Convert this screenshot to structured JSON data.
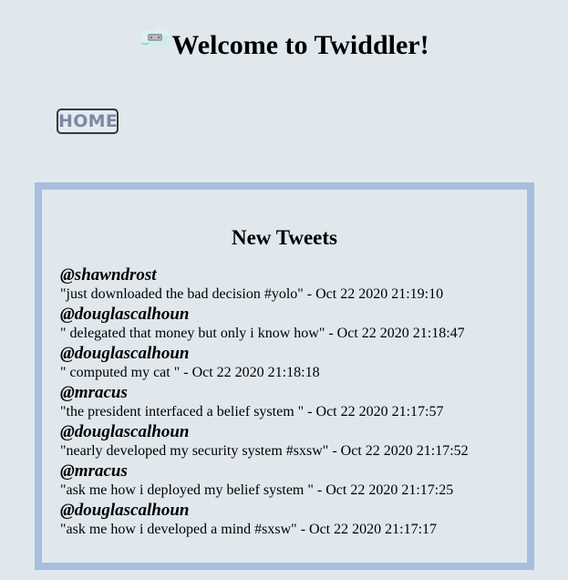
{
  "header": {
    "title": "Welcome to Twiddler!",
    "logo_icon": "cloud-bird-logo"
  },
  "nav": {
    "home_label": "HOME"
  },
  "feed": {
    "title": "New Tweets",
    "tweets": [
      {
        "handle": "@shawndrost",
        "text": "\"just downloaded the bad decision #yolo\" - Oct 22 2020 21:19:10"
      },
      {
        "handle": "@douglascalhoun",
        "text": "\" delegated that money but only i know how\" - Oct 22 2020 21:18:47"
      },
      {
        "handle": "@douglascalhoun",
        "text": "\" computed my cat \" - Oct 22 2020 21:18:18"
      },
      {
        "handle": "@mracus",
        "text": "\"the president interfaced a belief system \" - Oct 22 2020 21:17:57"
      },
      {
        "handle": "@douglascalhoun",
        "text": "\"nearly developed my security system #sxsw\" - Oct 22 2020 21:17:52"
      },
      {
        "handle": "@mracus",
        "text": "\"ask me how i deployed my belief system \" - Oct 22 2020 21:17:25"
      },
      {
        "handle": "@douglascalhoun",
        "text": "\"ask me how i developed a mind #sxsw\" - Oct 22 2020 21:17:17"
      }
    ]
  },
  "colors": {
    "background": "#e1e8ed",
    "feed_border": "#a7bfdd",
    "home_text": "#7b8aa0"
  }
}
